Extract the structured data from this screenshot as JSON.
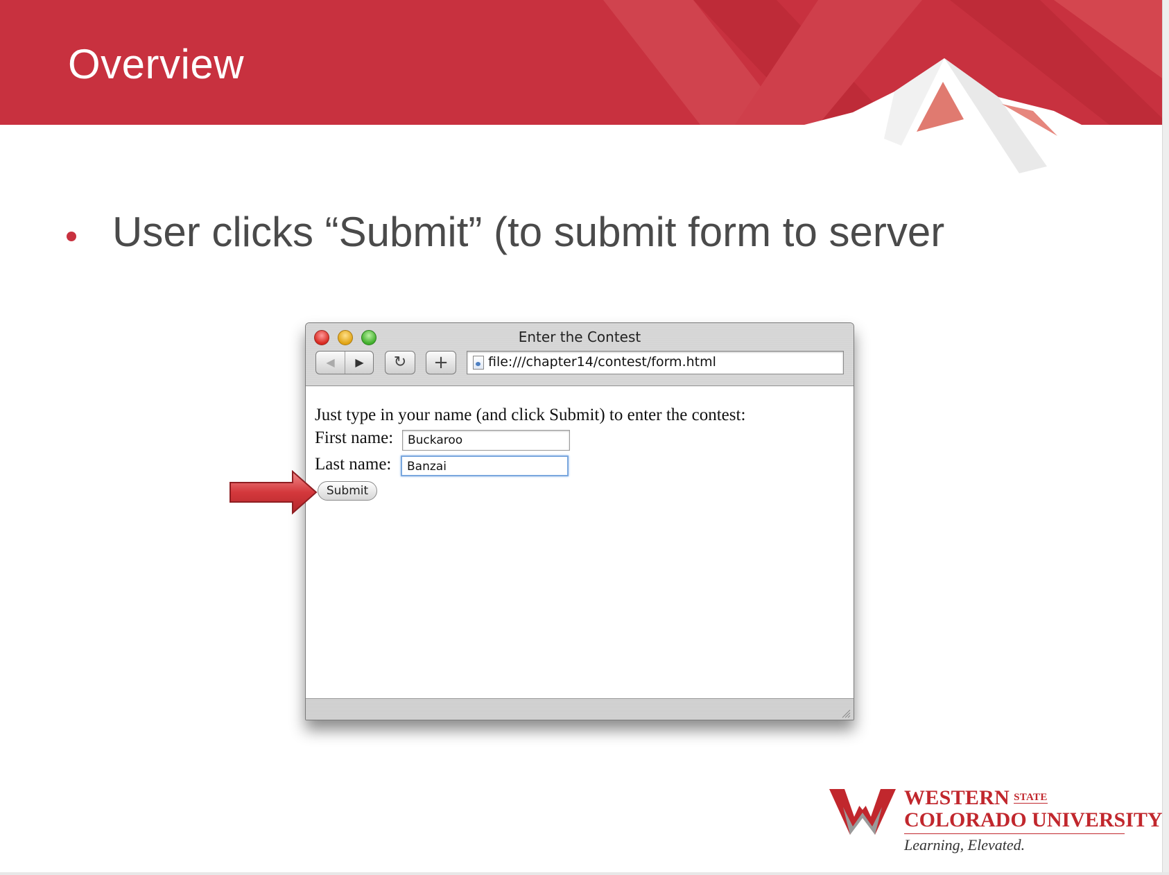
{
  "slide": {
    "title": "Overview",
    "bullet": "User clicks “Submit”  (to submit form to server"
  },
  "browser": {
    "window_title": "Enter the Contest",
    "url": "file:///chapter14/contest/form.html",
    "toolbar": {
      "back_icon": "◀",
      "forward_icon": "▶",
      "reload_icon": "↻",
      "add_icon": "+"
    },
    "page": {
      "intro": "Just type in your name (and click Submit) to enter the contest:",
      "first_name_label": "First name:",
      "first_name_value": "Buckaroo",
      "last_name_label": "Last name:",
      "last_name_value": "Banzai",
      "submit_label": "Submit"
    }
  },
  "logo": {
    "line1": "WESTERN",
    "state": "STATE",
    "line2": "COLORADO UNIVERSITY",
    "tagline": "Learning, Elevated."
  },
  "colors": {
    "brand_red": "#c8313f",
    "text_gray": "#4a4a4a"
  }
}
